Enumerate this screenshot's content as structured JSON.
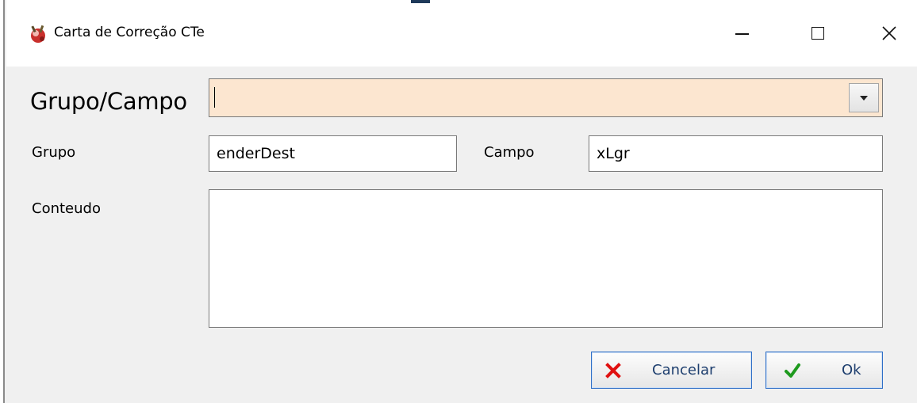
{
  "window": {
    "title": "Carta de Correção CTe",
    "icon": "app-icon",
    "controls": {
      "minimize_icon": "minimize-icon",
      "maximize_icon": "maximize-icon",
      "close_glyph": "✕"
    }
  },
  "form": {
    "grupo_campo": {
      "label": "Grupo/Campo",
      "value": "",
      "background": "#fce6d0",
      "dropdown_icon": "chevron-down-icon"
    },
    "grupo": {
      "label": "Grupo",
      "value": "enderDest"
    },
    "campo": {
      "label": "Campo",
      "value": "xLgr"
    },
    "conteudo": {
      "label": "Conteudo",
      "value": ""
    }
  },
  "actions": {
    "cancel": {
      "label": "Cancelar",
      "icon": "x-icon",
      "icon_color": "#e01010"
    },
    "ok": {
      "label": "Ok",
      "icon": "checkmark-icon",
      "icon_color": "#1e9a1e"
    }
  }
}
